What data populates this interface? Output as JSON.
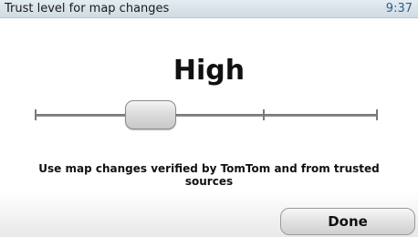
{
  "title_bar": {
    "title": "Trust level for map changes",
    "time": "9:37"
  },
  "setting": {
    "value_label": "High",
    "slider_positions": 4,
    "slider_selected_index": 1,
    "description": "Use map changes verified by TomTom and from trusted sources"
  },
  "actions": {
    "done_label": "Done"
  },
  "colors": {
    "title_bar": "#d6e1e7",
    "clock": "#2b5f8c",
    "slider_track": "#7a7a7a",
    "slider_thumb": "#dcdcdc"
  }
}
